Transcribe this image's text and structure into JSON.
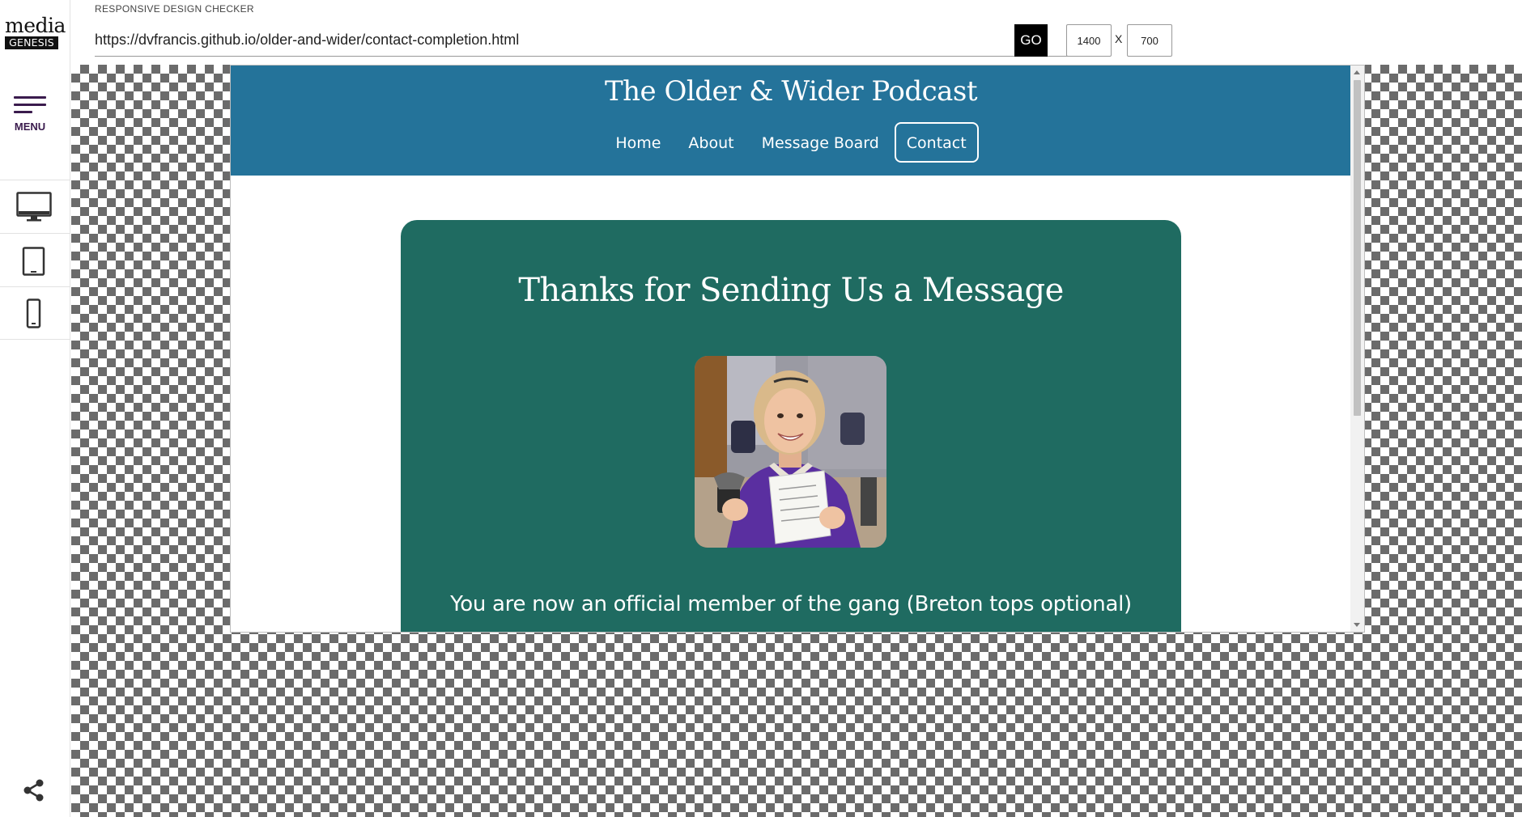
{
  "app": {
    "logo_line1": "media",
    "logo_line2": "GENESIS",
    "title": "RESPONSIVE DESIGN CHECKER",
    "menu_label": "MENU",
    "url": "https://dvfrancis.github.io/older-and-wider/contact-completion.html",
    "go_label": "GO",
    "width_value": "1400",
    "dim_separator": "X",
    "height_value": "700",
    "device_buttons": [
      "desktop-icon",
      "tablet-icon",
      "mobile-icon"
    ],
    "share_icon": "share-icon"
  },
  "site": {
    "title": "The Older & Wider Podcast",
    "nav": [
      {
        "label": "Home",
        "active": false
      },
      {
        "label": "About",
        "active": false
      },
      {
        "label": "Message Board",
        "active": false
      },
      {
        "label": "Contact",
        "active": true
      }
    ],
    "heading": "Thanks for Sending Us a Message",
    "body_text": "You are now an official member of the gang (Breton tops optional)"
  },
  "colors": {
    "site_header": "#24739a",
    "card": "#1f6b61",
    "menu_accent": "#3a1b4d"
  }
}
